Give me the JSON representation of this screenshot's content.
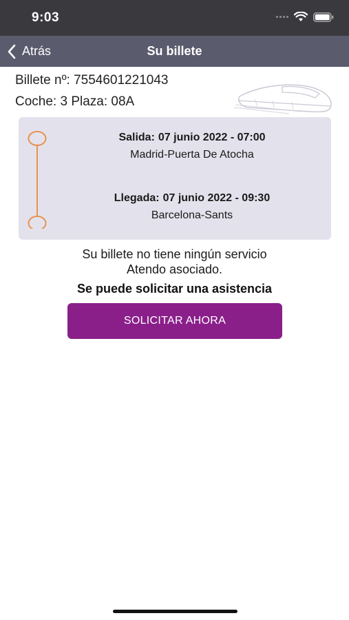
{
  "status_bar": {
    "time": "9:03"
  },
  "nav": {
    "back_label": "Atrás",
    "title": "Su billete"
  },
  "ticket": {
    "number_line": "Billete nº: 7554601221043",
    "seat_line": "Coche: 3 Plaza: 08A"
  },
  "journey": {
    "departure": {
      "label": "Salida:",
      "datetime": "07 junio 2022 - 07:00",
      "station": "Madrid-Puerta De Atocha"
    },
    "arrival": {
      "label": "Llegada:",
      "datetime": "07 junio 2022 - 09:30",
      "station": "Barcelona-Sants"
    }
  },
  "service": {
    "line1": "Su billete no tiene ningún servicio",
    "line2": "Atendo asociado.",
    "assist": "Se puede solicitar una asistencia",
    "button": "SOLICITAR AHORA"
  },
  "colors": {
    "nav_bg": "#5b5b6e",
    "status_bg": "#3a3a3e",
    "card_bg": "#e3e2ec",
    "route_accent": "#e8924f",
    "button_bg": "#8a1f8a"
  },
  "icons": [
    "back-chevron-icon",
    "wifi-icon",
    "battery-icon",
    "train-icon"
  ]
}
